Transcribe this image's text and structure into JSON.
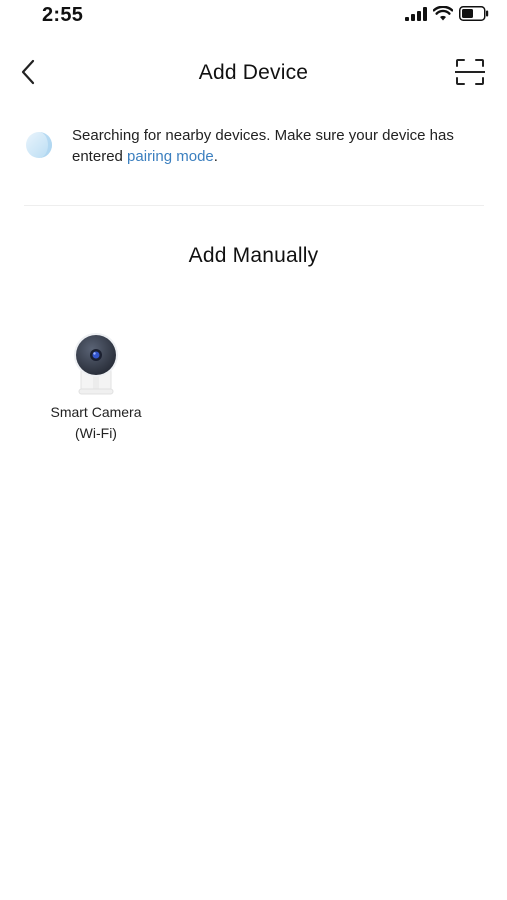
{
  "status_bar": {
    "time": "2:55",
    "icons": [
      "cellular-signal-icon",
      "wifi-icon",
      "battery-icon"
    ]
  },
  "header": {
    "title": "Add Device",
    "back_icon": "chevron-left-icon",
    "scan_icon": "scan-frame-icon"
  },
  "search": {
    "text": "Searching for nearby devices. Make sure your device has entered ",
    "link_text": "pairing mode",
    "suffix": ".",
    "link_color": "#3b7fbf",
    "spinner_color": "#cfe6f7"
  },
  "manual": {
    "title": "Add Manually",
    "devices": [
      {
        "name_line1": "Smart Camera",
        "name_line2": "(Wi-Fi)",
        "icon": "smart-camera-icon"
      }
    ]
  }
}
